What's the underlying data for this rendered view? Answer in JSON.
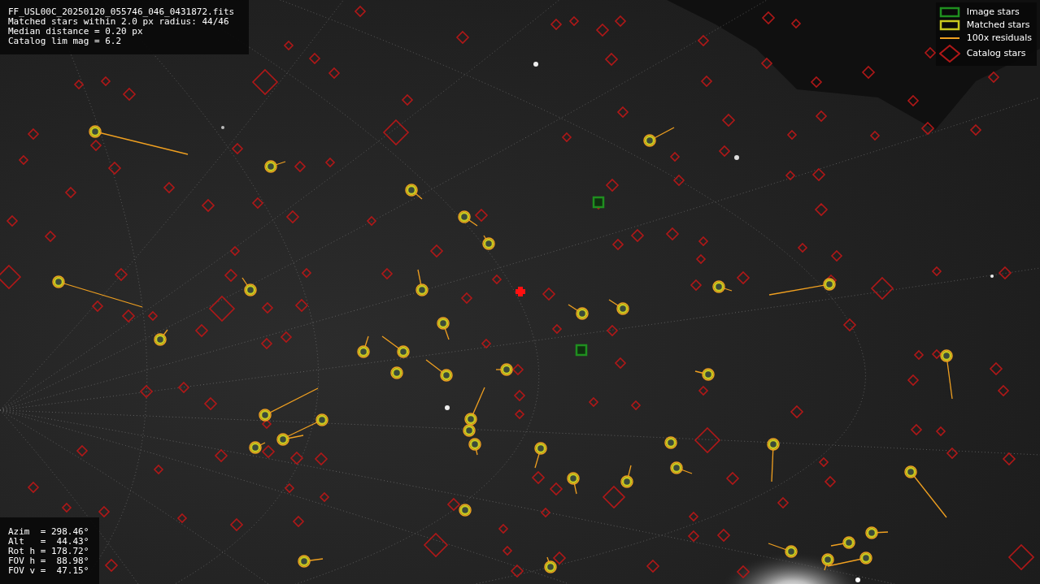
{
  "file_info": {
    "lines": [
      "FF_USL00C_20250120_055746_046_0431872.fits",
      "Matched stars within 2.0 px radius: 44/46",
      "Median distance = 0.20 px",
      "Catalog lim mag = 6.2"
    ]
  },
  "legend": {
    "items": [
      {
        "label": "Image stars",
        "kind": "box",
        "color": "#1f8f1f"
      },
      {
        "label": "Matched stars",
        "kind": "box",
        "color": "#c8c81e"
      },
      {
        "label": "100x residuals",
        "kind": "line",
        "color": "#f0a020"
      },
      {
        "label": "Catalog stars",
        "kind": "diamond",
        "color": "#b01818"
      }
    ]
  },
  "pointing": {
    "lines": [
      "Azim  = 298.46°",
      "Alt   =  44.43°",
      "Rot h = 178.72°",
      "FOV h =  88.98°",
      "FOV v =  47.15°"
    ]
  }
}
